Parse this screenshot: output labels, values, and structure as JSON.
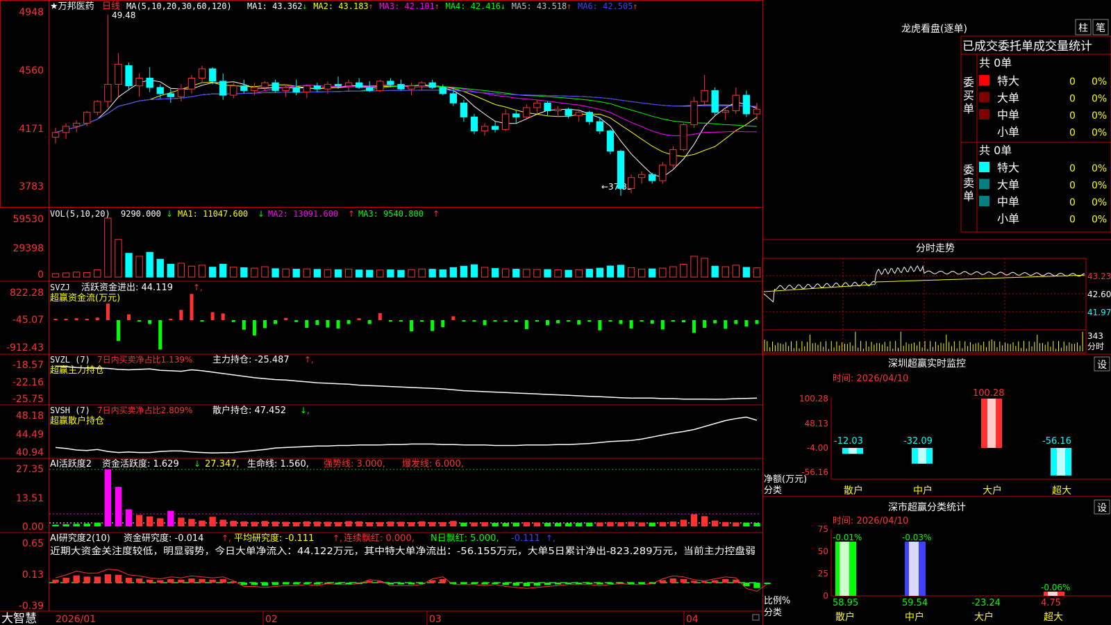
{
  "colors": {
    "up": "#ff3232",
    "down": "#00ffff",
    "grid": "#c00000",
    "yellow": "#ffff00",
    "magenta": "#ff00ff",
    "green": "#00ff00",
    "white": "#ffffff",
    "blue": "#4040ff",
    "gray": "#c0c0c0",
    "dark_red": "#800000",
    "teal": "#008080"
  },
  "main_panel": {
    "title": "★万邦医药",
    "period": "日线",
    "ma_prefix": "MA(5,10,20,30,60,120)",
    "ma_readouts": [
      {
        "label": "MA1: 43.362",
        "arrow": "↓",
        "color": "#ffffff"
      },
      {
        "label": "MA2: 43.183",
        "arrow": "↑",
        "color": "#ffff00"
      },
      {
        "label": "MA3: 42.101",
        "arrow": "↑",
        "color": "#ff00ff"
      },
      {
        "label": "MA4: 42.416",
        "arrow": "↓",
        "color": "#00ff00"
      },
      {
        "label": "MA5: 43.518",
        "arrow": "↑",
        "color": "#c0c0c0"
      },
      {
        "label": "MA6: 42.505",
        "arrow": "↑",
        "color": "#4040ff"
      }
    ],
    "yticks": [
      "4948",
      "4560",
      "4171",
      "3783"
    ],
    "high_marker": "49.48",
    "low_marker": "←37.83"
  },
  "vol_panel": {
    "header": "VOL(5,10,20)",
    "value": "9290.000",
    "arrow": "↓",
    "ma1": "MA1: 11047.600",
    "ma1_arrow": "↓",
    "ma2": "MA2: 13091.600",
    "ma2_arrow": "↑",
    "ma3": "MA3: 9540.800",
    "ma3_arrow": "↑",
    "yticks": [
      "59530",
      "29398",
      "0"
    ]
  },
  "svzj_panel": {
    "header": "SVZJ",
    "label": "活跃资金进出: 44.119",
    "arrow": "↑,",
    "subtitle": "超赢资金流(万元)",
    "yticks": [
      "822.28",
      "-45.07",
      "-912.43"
    ]
  },
  "svzl_panel": {
    "header": "SVZL (7)",
    "ratio": "7日内买卖净占比1.139%",
    "label": "主力持仓: -25.487",
    "arrow": "↑,",
    "subtitle": "超赢主力持仓",
    "yticks": [
      "-18.57",
      "-22.16",
      "-25.75"
    ]
  },
  "svsh_panel": {
    "header": "SVSH (7)",
    "ratio": "7日内买卖净占比2.809%",
    "label": "散户持仓: 47.452",
    "arrow": "↓,",
    "subtitle": "超赢散户持仓",
    "yticks": [
      "48.18",
      "44.49",
      "40.94"
    ]
  },
  "ai2_panel": {
    "header": "AI活跃度2",
    "label": "资金活跃度: 1.629",
    "arrow": "↓",
    "v2": "27.347,",
    "life": "生命线: 1.560,",
    "strong": "强势线: 3.000,",
    "burst": "爆发线: 6.000,",
    "yticks": [
      "27.35",
      "13.51",
      "0.00"
    ]
  },
  "air_panel": {
    "header": "AI研究度2(10)",
    "label": "资金研究度: -0.014",
    "arrow": "↑,",
    "avg": "平均研究度: -0.111",
    "avg_arrow": "↑,",
    "red": "连续飘红: 0.000,",
    "nred": "N日飘红: 5.000,",
    "last": "-0.111",
    "last_arrow": "↑,",
    "commentary": "近期大资金关注度较低，明显弱势，今日大单净流入：44.122万元，其中特大单净流出：-56.155万元，大单5日累计净出-823.289万元，当前主力控盘弱",
    "yticks": [
      "0.65",
      "0.13",
      "-0.39"
    ]
  },
  "xaxis": {
    "brand": "大智慧",
    "labels": [
      "2026/01",
      "02",
      "03",
      "04"
    ]
  },
  "right": {
    "lhb_title": "龙虎看盘(逐单)",
    "btn_zhu": "柱",
    "btn_bi": "笔",
    "stats_header": "已成交委托单成交量统计",
    "buy": {
      "side": "委买单",
      "total": "共 0单",
      "rows": [
        {
          "label": "特大",
          "value": "0",
          "pct": "0%",
          "color": "#ff0000"
        },
        {
          "label": "大单",
          "value": "0",
          "pct": "0%",
          "color": "#800000"
        },
        {
          "label": "中单",
          "value": "0",
          "pct": "0%",
          "color": "#800000"
        },
        {
          "label": "小单",
          "value": "0",
          "pct": "0%",
          "color": ""
        }
      ]
    },
    "sell": {
      "side": "委卖单",
      "total": "共 0单",
      "rows": [
        {
          "label": "特大",
          "value": "0",
          "pct": "0%",
          "color": "#00ffff"
        },
        {
          "label": "大单",
          "value": "0",
          "pct": "0%",
          "color": "#008080"
        },
        {
          "label": "中单",
          "value": "0",
          "pct": "0%",
          "color": "#008080"
        },
        {
          "label": "小单",
          "value": "0",
          "pct": "0%",
          "color": ""
        }
      ]
    },
    "intraday_title": "分时走势",
    "intraday_yticks": [
      "43.23",
      "42.60",
      "41.97"
    ],
    "intraday_vol": "343",
    "intraday_unit": "分时",
    "monitor": {
      "title": "深圳超赢实时监控",
      "set": "设",
      "time": "时间: 2026/04/10",
      "yticks": [
        "100.28",
        "48.13",
        "-4.00",
        "-56.16"
      ],
      "ylabel": "净额(万元)",
      "xlabel": "分类",
      "categories": [
        "散户",
        "中户",
        "大户",
        "超大"
      ],
      "values": [
        -12.03,
        -32.09,
        100.28,
        -56.16
      ],
      "value_labels": [
        "-12.03",
        "-32.09",
        "100.28",
        "-56.16"
      ]
    },
    "classify": {
      "title": "深市超赢分类统计",
      "set": "设",
      "time": "时间: 2026/04/10",
      "yticks": [
        "75",
        "50",
        "25",
        "0"
      ],
      "ylabel": "比例%",
      "xlabel": "分类",
      "categories": [
        "散户",
        "中户",
        "大户",
        "超大"
      ],
      "values": [
        58.95,
        59.54,
        -23.24,
        4.75
      ],
      "value_labels": [
        "58.95",
        "59.54",
        "-23.24",
        "4.75"
      ],
      "top_labels": [
        "-0.01%",
        "-0.03%",
        "",
        "-0.06%"
      ]
    }
  },
  "chart_data": [
    {
      "type": "candlestick",
      "title": "万邦医药 日线",
      "x": [
        "2026/01",
        "02",
        "03",
        "04"
      ],
      "ohlc": [
        [
          41.6,
          42.2,
          41.2,
          41.9
        ],
        [
          41.9,
          42.5,
          41.5,
          42.3
        ],
        [
          42.3,
          42.7,
          41.9,
          42.5
        ],
        [
          42.5,
          43.3,
          42.3,
          43.2
        ],
        [
          43.2,
          44.0,
          43.0,
          43.9
        ],
        [
          43.9,
          49.48,
          43.5,
          45.0
        ],
        [
          45.0,
          47.0,
          44.2,
          46.3
        ],
        [
          46.2,
          46.4,
          44.6,
          44.9
        ],
        [
          44.9,
          45.7,
          44.2,
          45.4
        ],
        [
          45.4,
          46.1,
          44.5,
          44.8
        ],
        [
          44.8,
          45.0,
          44.1,
          44.4
        ],
        [
          44.4,
          44.7,
          43.8,
          44.2
        ],
        [
          44.2,
          45.0,
          43.9,
          44.7
        ],
        [
          44.7,
          45.6,
          44.4,
          45.4
        ],
        [
          45.4,
          46.2,
          45.1,
          46.0
        ],
        [
          46.0,
          46.1,
          45.0,
          45.2
        ],
        [
          45.2,
          45.7,
          44.0,
          44.3
        ],
        [
          44.3,
          45.1,
          44.1,
          44.9
        ],
        [
          44.9,
          45.3,
          44.4,
          44.6
        ],
        [
          44.6,
          45.1,
          44.3,
          44.8
        ],
        [
          44.8,
          45.2,
          44.6,
          45.1
        ],
        [
          45.1,
          45.3,
          44.5,
          44.6
        ],
        [
          44.6,
          45.0,
          44.2,
          44.8
        ],
        [
          44.8,
          45.3,
          44.3,
          44.5
        ],
        [
          44.5,
          45.0,
          44.1,
          44.9
        ],
        [
          44.9,
          45.1,
          44.5,
          44.7
        ],
        [
          44.7,
          45.2,
          44.4,
          45.0
        ],
        [
          45.0,
          45.5,
          44.7,
          44.9
        ],
        [
          44.9,
          45.3,
          44.6,
          45.1
        ],
        [
          45.1,
          45.4,
          44.7,
          44.8
        ],
        [
          44.8,
          45.2,
          44.5,
          44.6
        ],
        [
          44.6,
          45.3,
          44.5,
          45.2
        ],
        [
          45.2,
          45.4,
          44.8,
          45.0
        ],
        [
          45.0,
          45.3,
          44.6,
          44.7
        ],
        [
          44.7,
          45.1,
          44.3,
          44.9
        ],
        [
          44.9,
          45.2,
          44.6,
          45.1
        ],
        [
          45.1,
          45.3,
          44.7,
          44.8
        ],
        [
          44.8,
          45.0,
          44.3,
          44.4
        ],
        [
          44.4,
          44.8,
          43.6,
          43.8
        ],
        [
          43.8,
          44.0,
          42.6,
          42.9
        ],
        [
          42.9,
          43.1,
          41.8,
          42.0
        ],
        [
          42.0,
          42.5,
          41.7,
          42.3
        ],
        [
          42.3,
          42.6,
          41.9,
          42.1
        ],
        [
          42.1,
          43.4,
          42.0,
          43.1
        ],
        [
          43.1,
          43.3,
          42.5,
          42.9
        ],
        [
          42.9,
          43.7,
          42.8,
          43.5
        ],
        [
          43.5,
          44.0,
          43.1,
          43.8
        ],
        [
          43.8,
          43.9,
          43.0,
          43.3
        ],
        [
          43.3,
          43.6,
          42.9,
          43.4
        ],
        [
          43.4,
          43.5,
          42.8,
          43.0
        ],
        [
          43.0,
          43.4,
          42.6,
          43.2
        ],
        [
          43.2,
          43.3,
          42.4,
          42.6
        ],
        [
          42.6,
          42.9,
          41.8,
          42.0
        ],
        [
          42.0,
          42.1,
          40.5,
          40.7
        ],
        [
          40.7,
          40.8,
          37.83,
          38.3
        ],
        [
          38.3,
          39.2,
          38.0,
          39.0
        ],
        [
          39.0,
          39.4,
          38.6,
          39.2
        ],
        [
          39.2,
          39.3,
          38.6,
          38.8
        ],
        [
          38.8,
          40.0,
          38.6,
          39.8
        ],
        [
          39.8,
          41.0,
          39.6,
          40.8
        ],
        [
          40.8,
          42.5,
          40.7,
          42.4
        ],
        [
          42.4,
          44.2,
          42.2,
          43.9
        ],
        [
          43.9,
          45.6,
          43.6,
          44.6
        ],
        [
          44.6,
          44.8,
          43.0,
          43.2
        ],
        [
          43.2,
          43.5,
          42.7,
          43.3
        ],
        [
          43.3,
          44.8,
          43.1,
          44.3
        ],
        [
          44.3,
          44.6,
          42.9,
          43.1
        ],
        [
          43.1,
          43.8,
          42.7,
          43.4
        ]
      ]
    },
    {
      "type": "bar",
      "title": "VOL",
      "values": [
        3500,
        4200,
        5000,
        4600,
        7400,
        59530,
        38000,
        24000,
        21000,
        25000,
        18000,
        13000,
        14000,
        11000,
        12000,
        10000,
        13000,
        10000,
        9500,
        9000,
        10500,
        8500,
        8200,
        8000,
        8300,
        7800,
        7600,
        7500,
        8100,
        7200,
        7000,
        7100,
        7300,
        6900,
        7600,
        8200,
        7900,
        7400,
        9600,
        11000,
        12500,
        9800,
        8700,
        8300,
        8000,
        7900,
        7700,
        7600,
        7300,
        6900,
        7400,
        8000,
        9000,
        11200,
        12000,
        9500,
        8100,
        8300,
        9000,
        10500,
        13000,
        21000,
        19000,
        11000,
        10500,
        12000,
        9800,
        9290
      ]
    },
    {
      "type": "bar",
      "title": "超赢资金流(万元)",
      "values": [
        30,
        40,
        60,
        20,
        80,
        520,
        -650,
        180,
        -40,
        -120,
        -920,
        40,
        320,
        820,
        -30,
        250,
        210,
        -60,
        -300,
        -480,
        -250,
        -120,
        70,
        -60,
        -240,
        -150,
        -230,
        -260,
        -120,
        60,
        -120,
        220,
        -40,
        -20,
        -350,
        -50,
        -340,
        -220,
        120,
        -40,
        -20,
        -160,
        -40,
        -20,
        -60,
        -280,
        -30,
        -160,
        -100,
        -20,
        -140,
        -50,
        -320,
        -40,
        -120,
        -260,
        -40,
        -110,
        -290,
        -30,
        -70,
        -400,
        -240,
        -100,
        -270,
        -120,
        -200,
        -120
      ]
    },
    {
      "type": "line",
      "title": "超赢主力持仓",
      "values": [
        -18.6,
        -18.7,
        -18.9,
        -19.0,
        -19.0,
        -19.1,
        -19.3,
        -19.4,
        -19.3,
        -19.2,
        -19.5,
        -19.6,
        -19.7,
        -19.4,
        -19.6,
        -19.9,
        -20.2,
        -20.5,
        -20.8,
        -21.1,
        -21.3,
        -21.5,
        -21.6,
        -21.8,
        -22.0,
        -22.2,
        -22.3,
        -22.4,
        -22.5,
        -22.7,
        -22.8,
        -22.9,
        -23.0,
        -23.1,
        -23.2,
        -23.3,
        -23.4,
        -23.5,
        -23.7,
        -23.9,
        -24.0,
        -24.1,
        -24.2,
        -24.3,
        -24.4,
        -24.5,
        -24.6,
        -24.7,
        -24.8,
        -24.9,
        -25.0,
        -25.1,
        -25.2,
        -25.3,
        -25.4,
        -25.5,
        -25.5,
        -25.5,
        -25.6,
        -25.6,
        -25.7,
        -25.7,
        -25.7,
        -25.75,
        -25.7,
        -25.6,
        -25.55,
        -25.49
      ]
    },
    {
      "type": "line",
      "title": "超赢散户持仓",
      "values": [
        42.0,
        41.8,
        41.5,
        41.4,
        41.6,
        41.2,
        41.0,
        41.1,
        41.0,
        41.0,
        41.2,
        41.3,
        41.3,
        41.1,
        41.0,
        40.9,
        40.95,
        41.0,
        41.2,
        41.4,
        41.6,
        41.9,
        42.0,
        42.1,
        42.2,
        42.3,
        42.3,
        42.4,
        42.4,
        42.5,
        42.5,
        42.5,
        42.6,
        42.6,
        42.7,
        42.7,
        42.7,
        42.6,
        42.6,
        42.5,
        42.5,
        42.5,
        42.4,
        42.4,
        42.4,
        42.5,
        42.5,
        42.5,
        42.6,
        42.6,
        42.7,
        42.8,
        43.0,
        43.2,
        43.3,
        43.4,
        43.7,
        44.1,
        44.5,
        44.9,
        45.2,
        45.6,
        46.2,
        46.8,
        47.4,
        47.8,
        48.1,
        47.45
      ]
    },
    {
      "type": "bar",
      "title": "AI活跃度2",
      "values": [
        0.8,
        1.0,
        1.2,
        1.3,
        1.8,
        27.35,
        19.0,
        8.2,
        5.5,
        4.8,
        3.9,
        7.5,
        4.2,
        3.6,
        2.8,
        4.6,
        3.2,
        2.7,
        2.4,
        2.2,
        2.6,
        2.3,
        2.2,
        2.0,
        2.4,
        2.3,
        2.2,
        2.1,
        2.5,
        2.4,
        2.0,
        2.1,
        2.3,
        2.2,
        2.0,
        2.4,
        2.1,
        2.0,
        2.6,
        1.8,
        1.9,
        2.0,
        1.7,
        1.6,
        1.8,
        2.0,
        1.9,
        1.7,
        1.6,
        1.5,
        1.7,
        1.8,
        1.9,
        2.1,
        2.0,
        2.2,
        1.9,
        1.8,
        2.1,
        2.3,
        3.2,
        5.8,
        4.9,
        2.8,
        2.1,
        1.9,
        1.8,
        1.629
      ]
    },
    {
      "type": "bar",
      "title": "AI研究度2(10)",
      "values": [
        0.05,
        0.08,
        0.12,
        0.1,
        0.1,
        0.14,
        0.13,
        0.08,
        0.07,
        0.05,
        0.04,
        0.06,
        0.05,
        0.07,
        0.06,
        0.05,
        0.06,
        0.02,
        -0.04,
        -0.04,
        -0.05,
        -0.04,
        -0.03,
        -0.03,
        -0.02,
        -0.03,
        -0.01,
        -0.02,
        -0.02,
        -0.01,
        0.03,
        0.02,
        -0.03,
        -0.03,
        -0.03,
        -0.02,
        0.04,
        0.06,
        -0.02,
        -0.02,
        -0.02,
        -0.03,
        -0.02,
        -0.04,
        -0.05,
        -0.06,
        -0.05,
        -0.04,
        -0.03,
        -0.02,
        -0.02,
        -0.02,
        -0.03,
        -0.02,
        -0.01,
        -0.02,
        -0.02,
        -0.01,
        0.04,
        0.07,
        0.06,
        0.03,
        0.02,
        0.04,
        0.06,
        0.05,
        -0.06,
        -0.09,
        -0.014
      ]
    }
  ]
}
